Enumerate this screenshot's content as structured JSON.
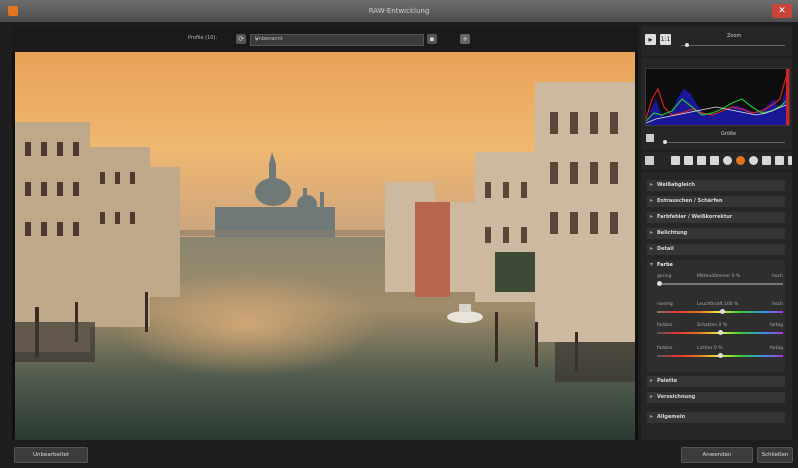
{
  "window": {
    "title": "RAW-Entwicklung",
    "close_glyph": "✕"
  },
  "topbar": {
    "profile_label": "Profile (10):",
    "profile_value": "Unbenannt",
    "add_glyph": "+",
    "save_glyph": "▪"
  },
  "sidebar": {
    "zoom_label": "Zoom",
    "size_label": "Größe",
    "sections_top": [
      "Weißabgleich",
      "Entrauschen / Schärfen",
      "Farbfehler / Weißkorrektur",
      "Belichtung",
      "Detail"
    ],
    "farbe": {
      "title": "Farbe",
      "sliders": [
        {
          "left": "gering",
          "center": "Mittendämmer  0  %",
          "right": "hoch",
          "value": 0.0
        },
        {
          "left": "niedrig",
          "center": "Leuchtkraft  100  %",
          "right": "hoch",
          "value": 0.52
        },
        {
          "left": "farblos",
          "center": "Schatten  0  %",
          "right": "farbig",
          "value": 0.5
        },
        {
          "left": "farblos",
          "center": "Lichter  0  %",
          "right": "farbig",
          "value": 0.5
        }
      ]
    },
    "sections_bottom": [
      "Palette",
      "Verzeichnung",
      "Allgemein"
    ]
  },
  "footer": {
    "reset_label": "Unbearbeitet",
    "apply_label": "Anwenden",
    "close_label": "Schließen"
  },
  "colors": {
    "accent": "#e2761f",
    "close": "#c9433b"
  }
}
